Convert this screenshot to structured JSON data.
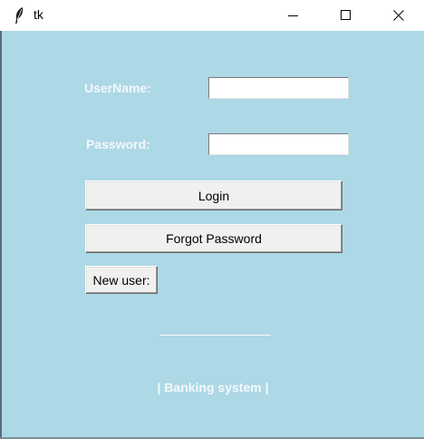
{
  "window": {
    "title": "tk",
    "background": "#add8e6",
    "controls": [
      "minimize-icon",
      "maximize-icon",
      "close-icon"
    ]
  },
  "form": {
    "username_label": "UserName:",
    "username_value": "",
    "password_label": "Password:",
    "password_value": "",
    "login_label": "Login",
    "forgot_label": "Forgot Password",
    "new_user_label": "New user:"
  },
  "footer": {
    "text": "| Banking system |"
  }
}
